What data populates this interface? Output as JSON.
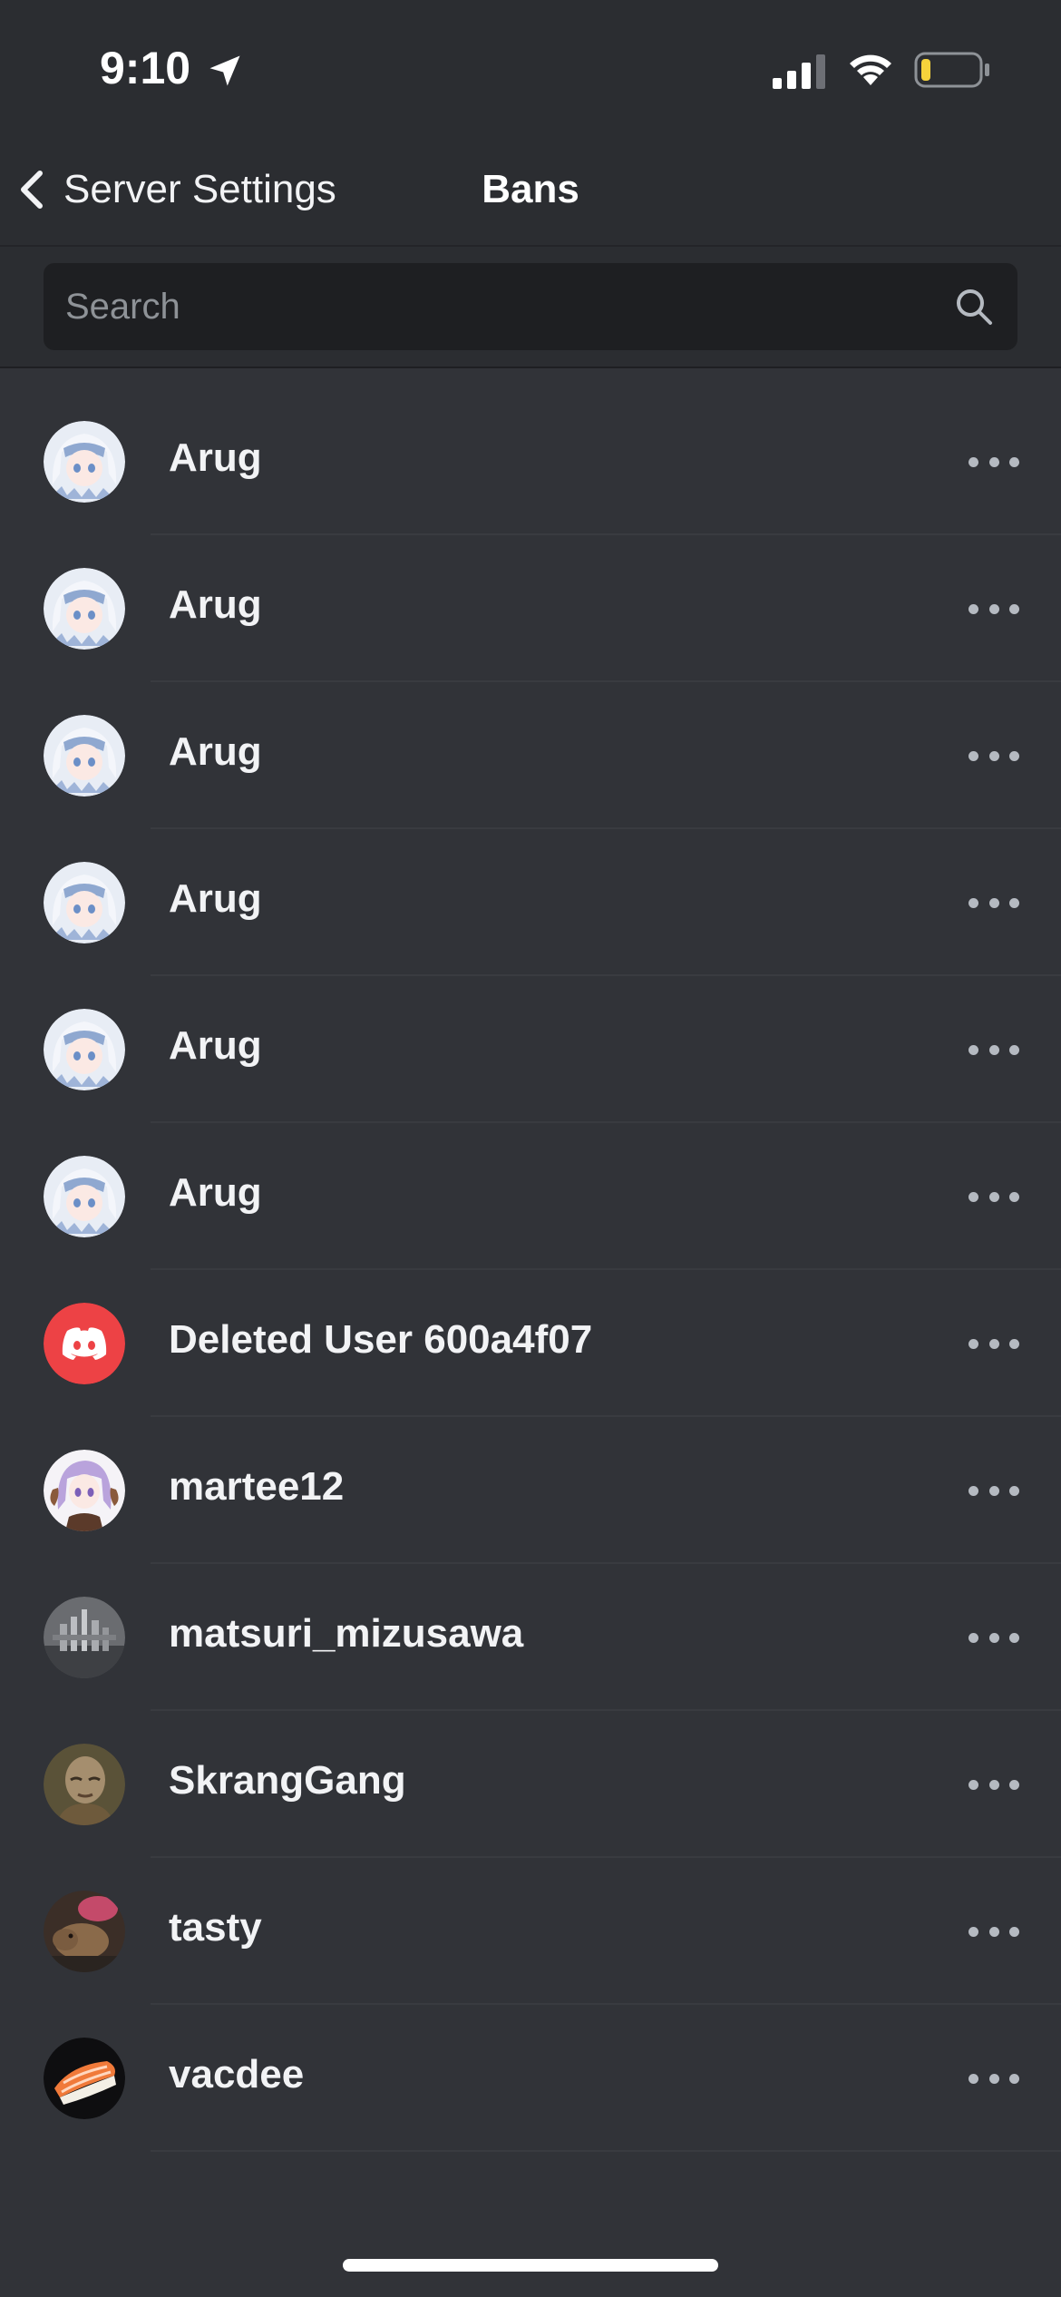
{
  "status_bar": {
    "time": "9:10"
  },
  "nav": {
    "back_label": "Server Settings",
    "title": "Bans"
  },
  "search": {
    "placeholder": "Search",
    "value": ""
  },
  "bans": [
    {
      "username": "Arug",
      "avatar": "anime-girl-white-hair"
    },
    {
      "username": "Arug",
      "avatar": "anime-girl-white-hair"
    },
    {
      "username": "Arug",
      "avatar": "anime-girl-white-hair"
    },
    {
      "username": "Arug",
      "avatar": "anime-girl-white-hair"
    },
    {
      "username": "Arug",
      "avatar": "anime-girl-white-hair"
    },
    {
      "username": "Arug",
      "avatar": "anime-girl-white-hair"
    },
    {
      "username": "Deleted User 600a4f07",
      "avatar": "discord-default-red"
    },
    {
      "username": "martee12",
      "avatar": "anime-girl-purple-hair"
    },
    {
      "username": "matsuri_mizusawa",
      "avatar": "city-skyline-grayscale"
    },
    {
      "username": "SkrangGang",
      "avatar": "bald-man"
    },
    {
      "username": "tasty",
      "avatar": "capybara-photo"
    },
    {
      "username": "vacdee",
      "avatar": "salmon-sushi"
    }
  ],
  "colors": {
    "background": "#313338",
    "header": "#2b2d31",
    "search_field": "#1e1f22",
    "deleted_user_avatar": "#ed4245"
  }
}
